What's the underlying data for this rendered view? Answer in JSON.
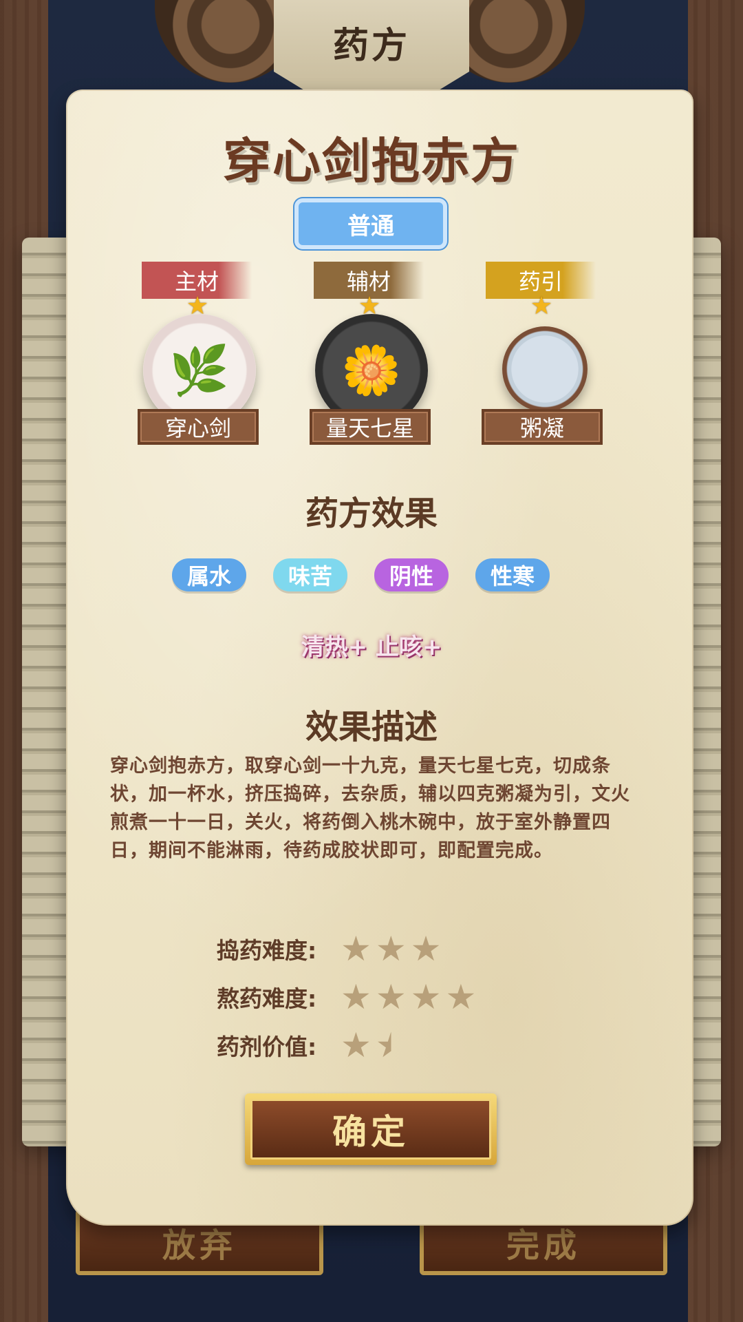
{
  "header": {
    "title": "药方"
  },
  "recipe": {
    "name": "穿心剑抱赤方",
    "grade": "普通",
    "grade_color": "#6fb3f0"
  },
  "ingredients": [
    {
      "role": "主材",
      "role_color": "#c25454",
      "name": "穿心剑",
      "stars": 1,
      "icon": "herb-plate-icon"
    },
    {
      "role": "辅材",
      "role_color": "#8e6a3c",
      "name": "量天七星",
      "stars": 1,
      "icon": "flower-plate-icon"
    },
    {
      "role": "药引",
      "role_color": "#d4a21f",
      "name": "粥凝",
      "stars": 1,
      "icon": "bowl-icon"
    }
  ],
  "effects": {
    "heading": "药方效果",
    "tags": [
      {
        "label": "属水",
        "color": "#5ea6ea"
      },
      {
        "label": "味苦",
        "color": "#7fd8ee"
      },
      {
        "label": "阴性",
        "color": "#b864e0"
      },
      {
        "label": "性寒",
        "color": "#5ea6ea"
      }
    ],
    "bonus": "清热+ 止咳+"
  },
  "description": {
    "heading": "效果描述",
    "text": "穿心剑抱赤方，取穿心剑一十九克，量天七星七克，切成条状，加一杯水，挤压捣碎，去杂质，辅以四克粥凝为引，文火煎煮一十一日，关火，将药倒入桃木碗中，放于室外静置四日，期间不能淋雨，待药成胶状即可，即配置完成。"
  },
  "ratings": [
    {
      "label": "捣药难度:",
      "value": 3
    },
    {
      "label": "熬药难度:",
      "value": 4
    },
    {
      "label": "药剂价值:",
      "value": 1.5
    }
  ],
  "buttons": {
    "confirm": "确定",
    "abandon": "放弃",
    "complete": "完成"
  }
}
